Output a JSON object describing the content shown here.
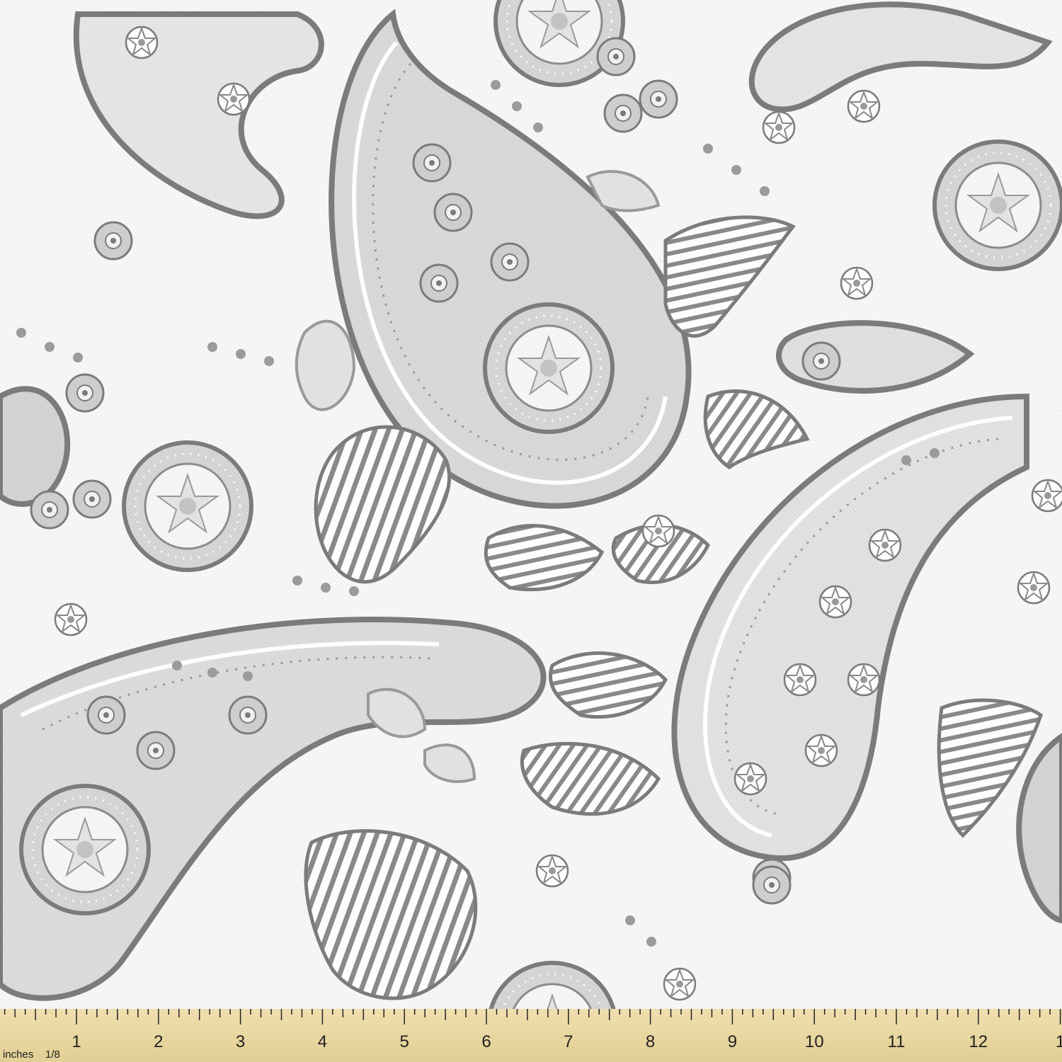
{
  "image": {
    "subject": "paisley-fabric-swatch",
    "palette": {
      "background": "#f7f7f7",
      "light_gray": "#d4d4d4",
      "mid_gray": "#b3b3b3",
      "dark_gray": "#7c7c7c",
      "ruler_wood": "#ead9a6",
      "ruler_ink": "#222222"
    }
  },
  "ruler": {
    "unit_label": "inches",
    "fraction_label": "1/8",
    "numbers": [
      "1",
      "2",
      "3",
      "4",
      "5",
      "6",
      "7",
      "8",
      "9",
      "10",
      "11",
      "12",
      "1"
    ]
  }
}
